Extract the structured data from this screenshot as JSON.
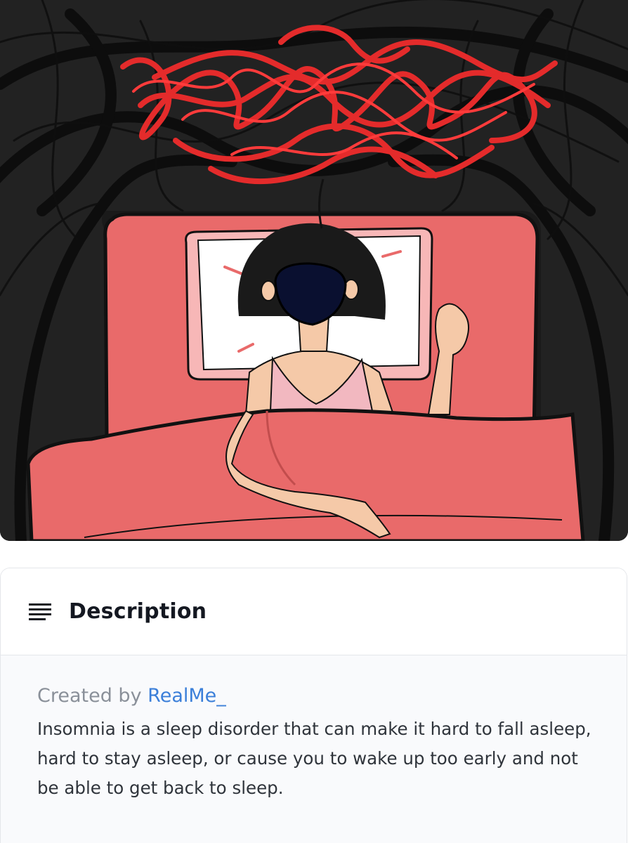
{
  "illustration": {
    "alt": "insomnia-illustration",
    "colors": {
      "background": "#222222",
      "scribble": "#e42b2b",
      "bed": "#e96a6a",
      "pillow": "#ffffff",
      "skin": "#f5c9a8",
      "hair": "#1a1a1a"
    }
  },
  "description": {
    "icon": "text-lines-icon",
    "title": "Description",
    "created_by_label": "Created by",
    "author": "RealMe_",
    "text": "Insomnia is a sleep disorder that can make it hard to fall asleep, hard to stay asleep, or cause you to wake up too early and not be able to get back to sleep."
  }
}
